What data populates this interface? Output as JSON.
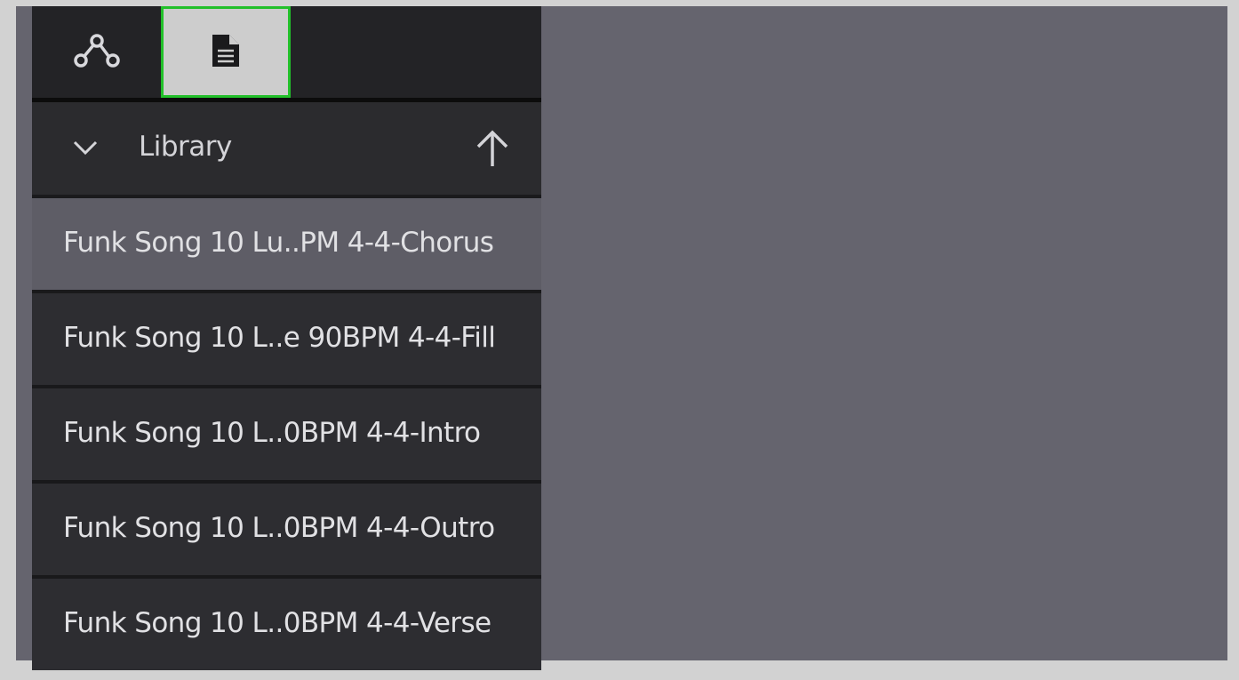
{
  "tabs": [
    {
      "icon": "graph-nodes-icon",
      "selected": false
    },
    {
      "icon": "document-icon",
      "selected": true
    }
  ],
  "library": {
    "title": "Library",
    "collapse_icon": "chevron-down-icon",
    "up_icon": "arrow-up-icon"
  },
  "items": [
    {
      "label": "Funk Song 10 Lu..PM 4-4-Chorus",
      "selected": true
    },
    {
      "label": "Funk Song 10 L..e 90BPM 4-4-Fill",
      "selected": false
    },
    {
      "label": "Funk Song 10 L..0BPM 4-4-Intro",
      "selected": false
    },
    {
      "label": "Funk Song 10 L..0BPM 4-4-Outro",
      "selected": false
    },
    {
      "label": "Funk Song 10 L..0BPM 4-4-Verse",
      "selected": false
    }
  ],
  "colors": {
    "accent_border": "#22c02a",
    "selected_row": "#5e5d66",
    "row": "#2d2d31",
    "workspace": "#65646e"
  }
}
